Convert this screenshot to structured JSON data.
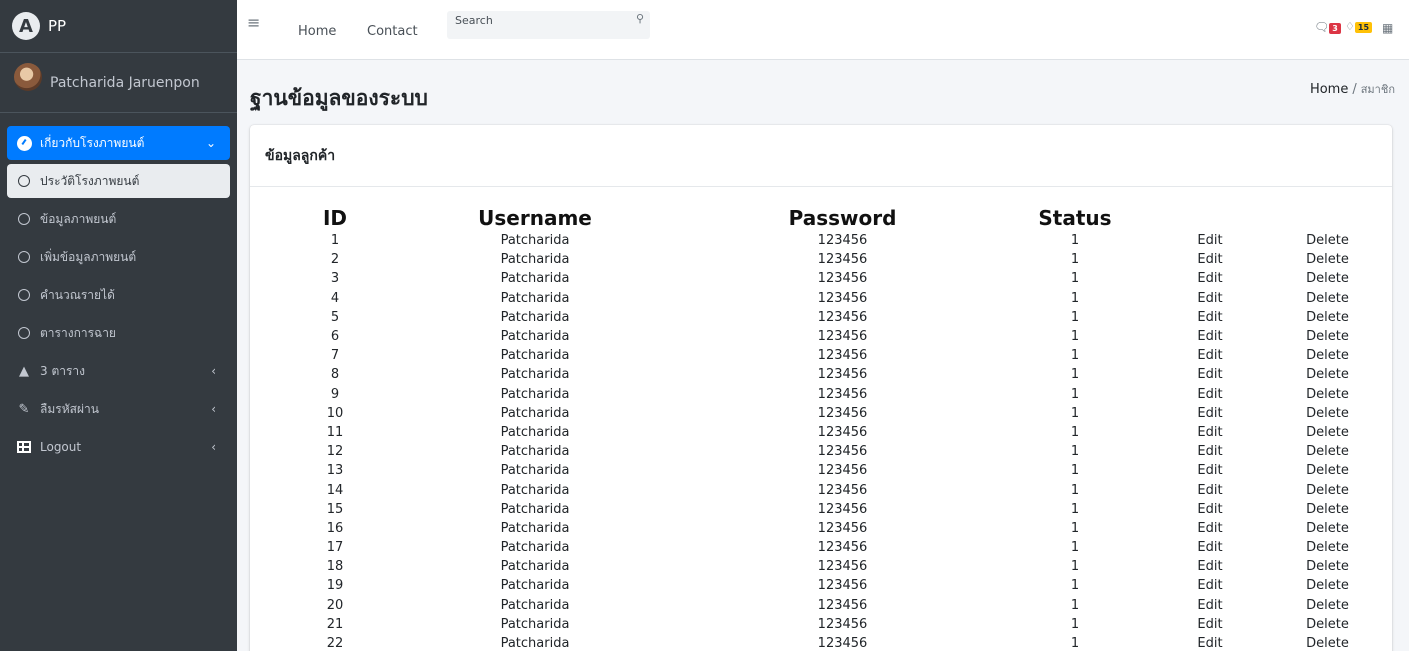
{
  "brand": {
    "logo_letter": "A",
    "name": "PP"
  },
  "user": {
    "name": "Patcharida Jaruenpon"
  },
  "sidebar": {
    "items": [
      {
        "label": "เกี่ยวกับโรงภาพยนต์",
        "icon": "dashboard-icon",
        "state": "active-parent",
        "arrow": "chevron-down"
      },
      {
        "label": "ประวัติโรงภาพยนต์",
        "icon": "circle-icon",
        "state": "current"
      },
      {
        "label": "ข้อมูลภาพยนต์",
        "icon": "circle-icon"
      },
      {
        "label": "เพิ่มข้อมูลภาพยนต์",
        "icon": "circle-icon"
      },
      {
        "label": "คำนวณรายได้",
        "icon": "circle-icon"
      },
      {
        "label": "ตารางการฉาย",
        "icon": "circle-icon"
      },
      {
        "label": "3 ตาราง",
        "icon": "tree-icon",
        "arrow": "chevron-left"
      },
      {
        "label": "ลืมรหัสผ่าน",
        "icon": "edit-icon",
        "arrow": "chevron-left"
      },
      {
        "label": "Logout",
        "icon": "table-icon",
        "arrow": "chevron-left"
      }
    ]
  },
  "topbar": {
    "home": "Home",
    "contact": "Contact",
    "search_placeholder": "Search",
    "messages_count": "3",
    "notifications_count": "15"
  },
  "page": {
    "title": "ฐานข้อมูลของระบบ",
    "breadcrumb_home": "Home",
    "breadcrumb_sep": "/",
    "breadcrumb_current": "สมาชิก",
    "card_title": "ข้อมูลลูกค้า"
  },
  "table": {
    "headers": [
      "ID",
      "Username",
      "Password",
      "Status"
    ],
    "rows": [
      {
        "id": "1",
        "username": "Patcharida",
        "password": "123456",
        "status": "1",
        "edit": "Edit",
        "delete": "Delete"
      },
      {
        "id": "2",
        "username": "Patcharida",
        "password": "123456",
        "status": "1",
        "edit": "Edit",
        "delete": "Delete"
      },
      {
        "id": "3",
        "username": "Patcharida",
        "password": "123456",
        "status": "1",
        "edit": "Edit",
        "delete": "Delete"
      },
      {
        "id": "4",
        "username": "Patcharida",
        "password": "123456",
        "status": "1",
        "edit": "Edit",
        "delete": "Delete"
      },
      {
        "id": "5",
        "username": "Patcharida",
        "password": "123456",
        "status": "1",
        "edit": "Edit",
        "delete": "Delete"
      },
      {
        "id": "6",
        "username": "Patcharida",
        "password": "123456",
        "status": "1",
        "edit": "Edit",
        "delete": "Delete"
      },
      {
        "id": "7",
        "username": "Patcharida",
        "password": "123456",
        "status": "1",
        "edit": "Edit",
        "delete": "Delete"
      },
      {
        "id": "8",
        "username": "Patcharida",
        "password": "123456",
        "status": "1",
        "edit": "Edit",
        "delete": "Delete"
      },
      {
        "id": "9",
        "username": "Patcharida",
        "password": "123456",
        "status": "1",
        "edit": "Edit",
        "delete": "Delete"
      },
      {
        "id": "10",
        "username": "Patcharida",
        "password": "123456",
        "status": "1",
        "edit": "Edit",
        "delete": "Delete"
      },
      {
        "id": "11",
        "username": "Patcharida",
        "password": "123456",
        "status": "1",
        "edit": "Edit",
        "delete": "Delete"
      },
      {
        "id": "12",
        "username": "Patcharida",
        "password": "123456",
        "status": "1",
        "edit": "Edit",
        "delete": "Delete"
      },
      {
        "id": "13",
        "username": "Patcharida",
        "password": "123456",
        "status": "1",
        "edit": "Edit",
        "delete": "Delete"
      },
      {
        "id": "14",
        "username": "Patcharida",
        "password": "123456",
        "status": "1",
        "edit": "Edit",
        "delete": "Delete"
      },
      {
        "id": "15",
        "username": "Patcharida",
        "password": "123456",
        "status": "1",
        "edit": "Edit",
        "delete": "Delete"
      },
      {
        "id": "16",
        "username": "Patcharida",
        "password": "123456",
        "status": "1",
        "edit": "Edit",
        "delete": "Delete"
      },
      {
        "id": "17",
        "username": "Patcharida",
        "password": "123456",
        "status": "1",
        "edit": "Edit",
        "delete": "Delete"
      },
      {
        "id": "18",
        "username": "Patcharida",
        "password": "123456",
        "status": "1",
        "edit": "Edit",
        "delete": "Delete"
      },
      {
        "id": "19",
        "username": "Patcharida",
        "password": "123456",
        "status": "1",
        "edit": "Edit",
        "delete": "Delete"
      },
      {
        "id": "20",
        "username": "Patcharida",
        "password": "123456",
        "status": "1",
        "edit": "Edit",
        "delete": "Delete"
      },
      {
        "id": "21",
        "username": "Patcharida",
        "password": "123456",
        "status": "1",
        "edit": "Edit",
        "delete": "Delete"
      },
      {
        "id": "22",
        "username": "Patcharida",
        "password": "123456",
        "status": "1",
        "edit": "Edit",
        "delete": "Delete"
      }
    ]
  },
  "colors": {
    "sidebar_bg": "#343a40",
    "active_item": "#007bff",
    "messages_badge": "#dc3545",
    "notifications_badge": "#ffc107"
  }
}
